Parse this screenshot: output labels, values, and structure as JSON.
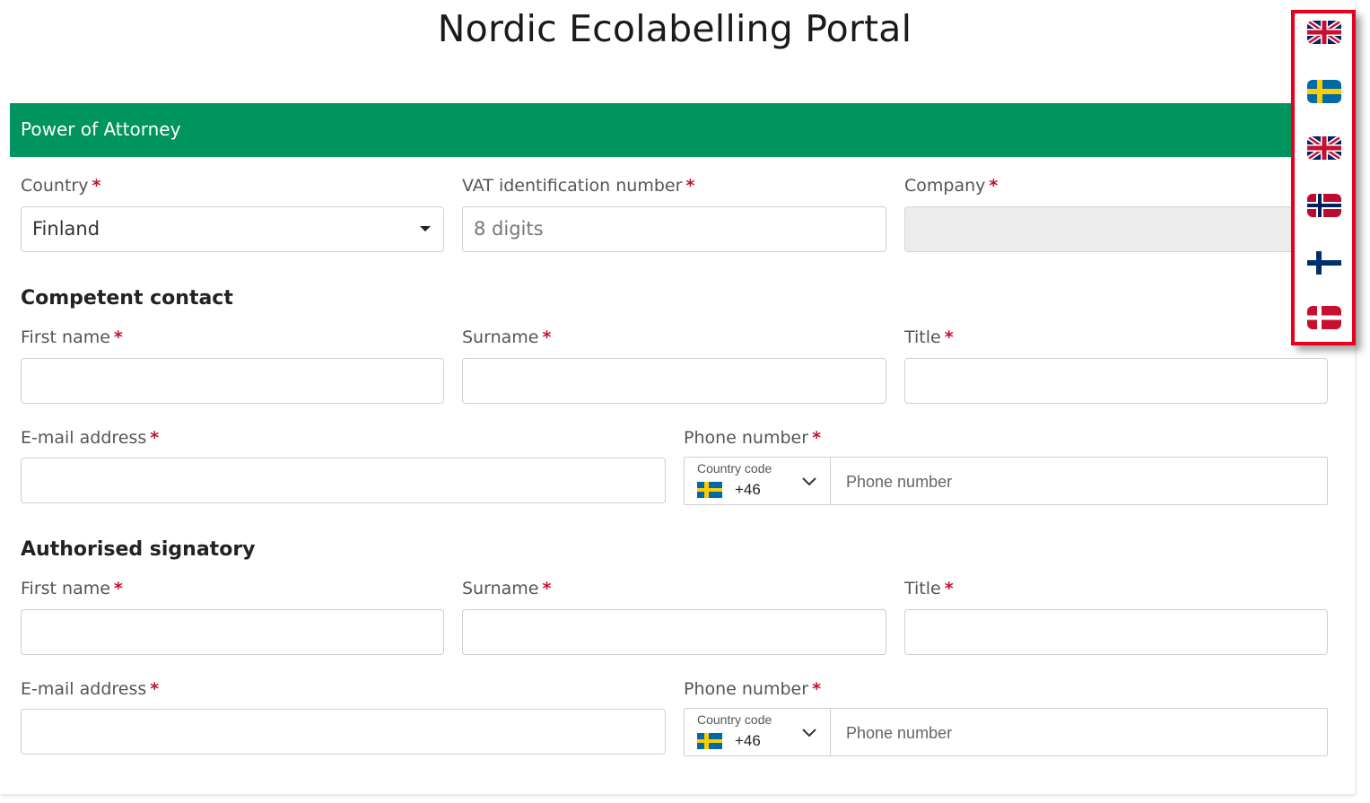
{
  "header": {
    "title": "Nordic Ecolabelling Portal"
  },
  "section": {
    "title": "Power of Attorney"
  },
  "company_info": {
    "country_label": "Country",
    "country_value": "Finland",
    "vat_label": "VAT identification number",
    "vat_placeholder": "8 digits",
    "company_label": "Company",
    "required_mark": "*"
  },
  "competent_contact": {
    "heading": "Competent contact",
    "first_name_label": "First name",
    "surname_label": "Surname",
    "title_label": "Title",
    "email_label": "E-mail address",
    "phone_label": "Phone number",
    "country_code_label": "Country code",
    "country_code_value": "+46",
    "phone_placeholder": "Phone number"
  },
  "authorised_signatory": {
    "heading": "Authorised signatory",
    "first_name_label": "First name",
    "surname_label": "Surname",
    "title_label": "Title",
    "email_label": "E-mail address",
    "phone_label": "Phone number",
    "country_code_label": "Country code",
    "country_code_value": "+46",
    "phone_placeholder": "Phone number"
  },
  "language_selector": {
    "flags": [
      "uk-flag-icon",
      "sweden-flag-icon",
      "uk-flag-icon",
      "norway-flag-icon",
      "finland-flag-icon",
      "denmark-flag-icon"
    ],
    "highlight_color": "#e8001c"
  },
  "colors": {
    "section_bar": "#00945e",
    "required": "#c8102e"
  }
}
